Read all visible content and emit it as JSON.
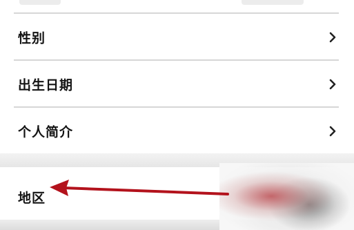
{
  "settings_list": {
    "items": [
      {
        "label": "性别",
        "icon": "chevron-right-icon"
      },
      {
        "label": "出生日期",
        "icon": "chevron-right-icon"
      },
      {
        "label": "个人简介",
        "icon": "chevron-right-icon"
      }
    ],
    "region_item": {
      "label": "地区"
    }
  },
  "annotation": {
    "arrow_color": "#b3121c"
  }
}
